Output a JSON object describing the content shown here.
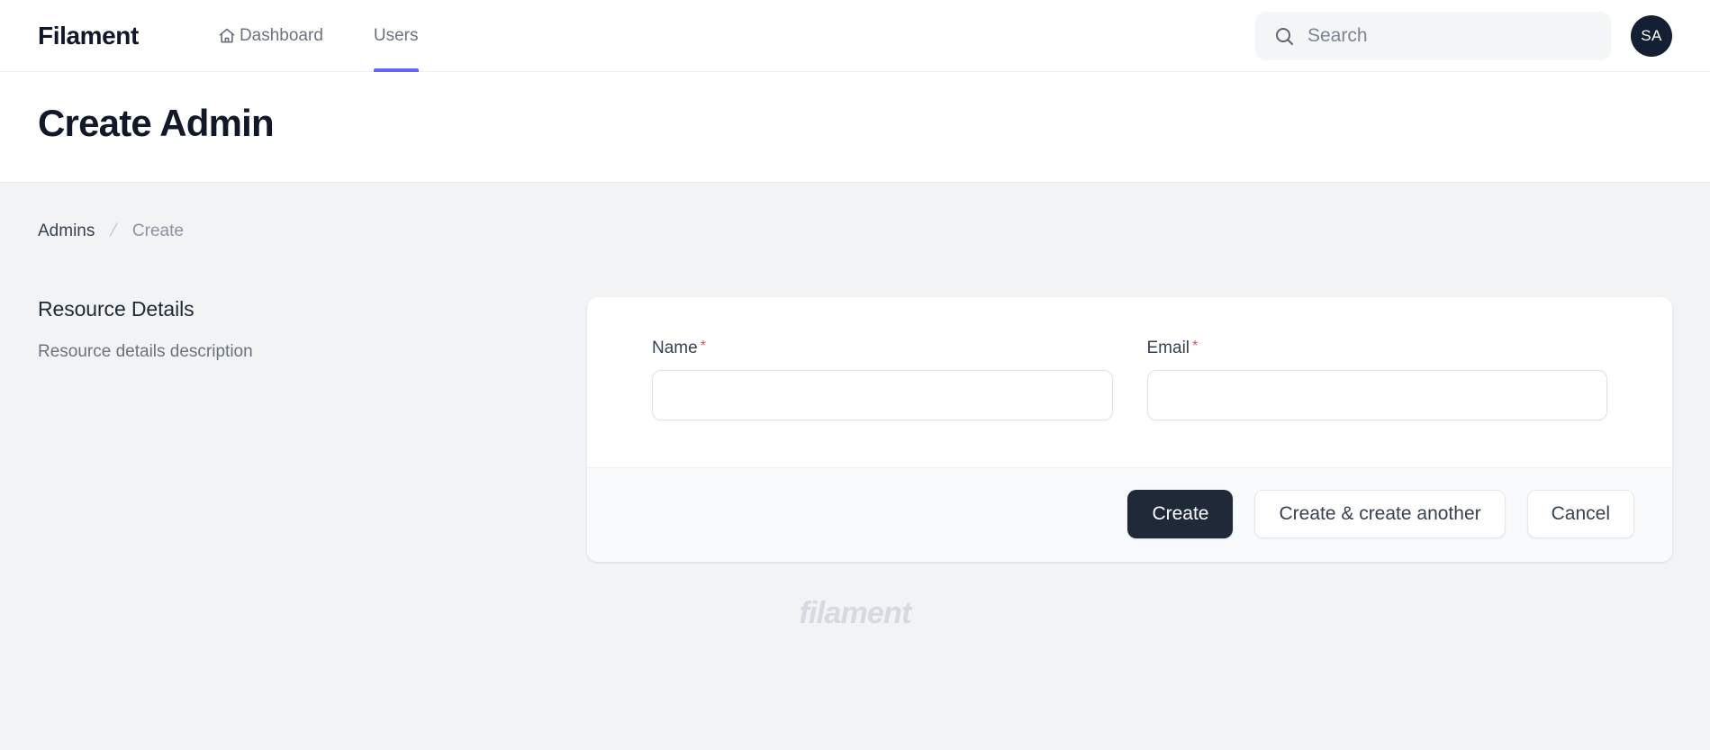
{
  "topbar": {
    "brand": "Filament",
    "nav": [
      {
        "label": "Dashboard",
        "icon": "home-icon",
        "active": false
      },
      {
        "label": "Users",
        "icon": "",
        "active": true
      }
    ],
    "search": {
      "placeholder": "Search",
      "value": "",
      "icon": "search-icon"
    },
    "avatar": {
      "initials": "SA"
    },
    "accent_color": "#6366f1"
  },
  "page": {
    "title": "Create Admin"
  },
  "breadcrumb": {
    "parent": "Admins",
    "separator": "/",
    "current": "Create"
  },
  "section": {
    "title": "Resource Details",
    "description": "Resource details description"
  },
  "form": {
    "fields": [
      {
        "label": "Name",
        "required_mark": "*",
        "value": "",
        "placeholder": ""
      },
      {
        "label": "Email",
        "required_mark": "*",
        "value": "",
        "placeholder": ""
      }
    ],
    "required_color": "#d4506a"
  },
  "actions": {
    "primary": "Create",
    "secondary": "Create & create another",
    "cancel": "Cancel"
  },
  "footer": {
    "logo_text": "filament"
  }
}
